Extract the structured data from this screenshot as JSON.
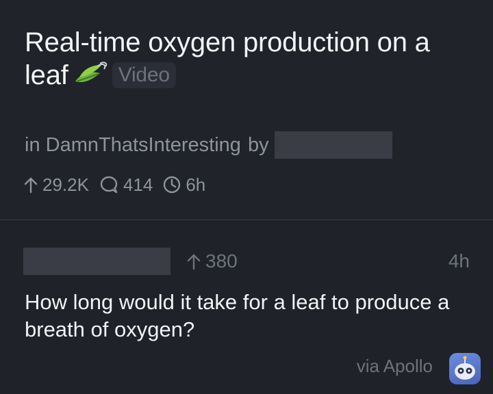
{
  "post": {
    "title_text": "Real-time oxygen production on a leaf",
    "emoji_icon": "leaf-fluttering-in-wind-icon",
    "badge": "Video",
    "meta_in": "in DamnThatsInteresting",
    "meta_by": "by",
    "upvotes": "29.2K",
    "comments": "414",
    "age": "6h"
  },
  "comment": {
    "votes": "380",
    "age": "4h",
    "body": "How long would it take for a leaf to produce a breath of oxygen?",
    "via": "via Apollo",
    "app_icon": "apollo-app-icon"
  },
  "colors": {
    "background": "#1f2229",
    "muted": "#8f939c",
    "redaction": "#3a3d45"
  }
}
